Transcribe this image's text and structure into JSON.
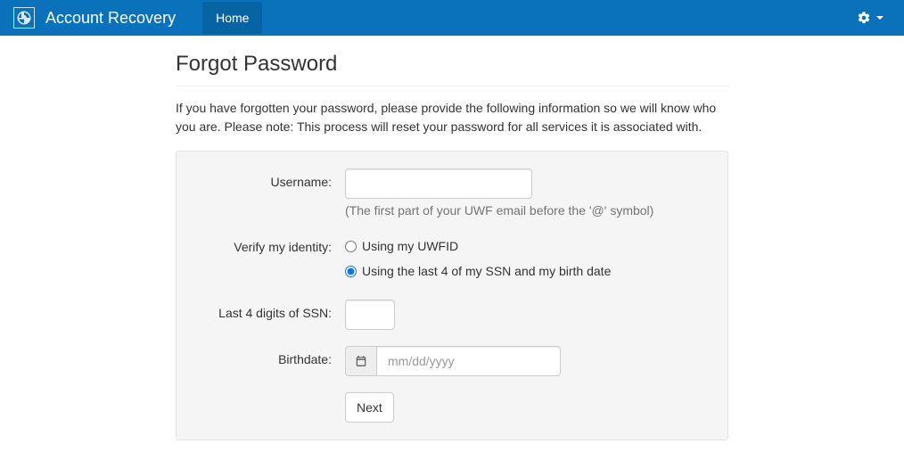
{
  "navbar": {
    "brand": "Account Recovery",
    "home_label": "Home"
  },
  "page": {
    "title": "Forgot Password",
    "intro": "If you have forgotten your password, please provide the following information so we will know who you are. Please note: This process will reset your password for all services it is associated with."
  },
  "form": {
    "username": {
      "label": "Username:",
      "value": "",
      "help": "(The first part of your UWF email before the '@' symbol)"
    },
    "verify": {
      "label": "Verify my identity:",
      "options": [
        {
          "label": "Using my UWFID",
          "selected": false
        },
        {
          "label": "Using the last 4 of my SSN and my birth date",
          "selected": true
        }
      ]
    },
    "ssn": {
      "label": "Last 4 digits of SSN:",
      "value": ""
    },
    "birthdate": {
      "label": "Birthdate:",
      "value": "",
      "placeholder": "mm/dd/yyyy"
    },
    "next_label": "Next"
  }
}
